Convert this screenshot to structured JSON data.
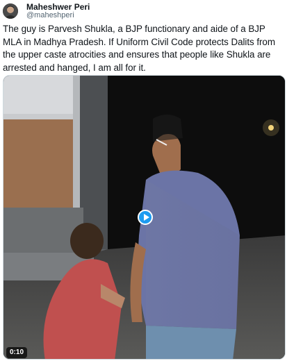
{
  "author": {
    "display_name": "Maheshwer Peri",
    "handle": "@maheshperi"
  },
  "tweet": {
    "text": "The guy is Parvesh Shukla, a BJP functionary and aide of a BJP MLA in Madhya Pradesh. If Uniform Civil Code protects Dalits from the upper caste atrocities and ensures that people like Shukla are arrested and hanged, I am all for it."
  },
  "media": {
    "type": "video",
    "duration": "0:10",
    "play_icon": "play-icon"
  },
  "colors": {
    "accent": "#1d9bf0",
    "text_primary": "#0f1419",
    "text_secondary": "#536471"
  }
}
